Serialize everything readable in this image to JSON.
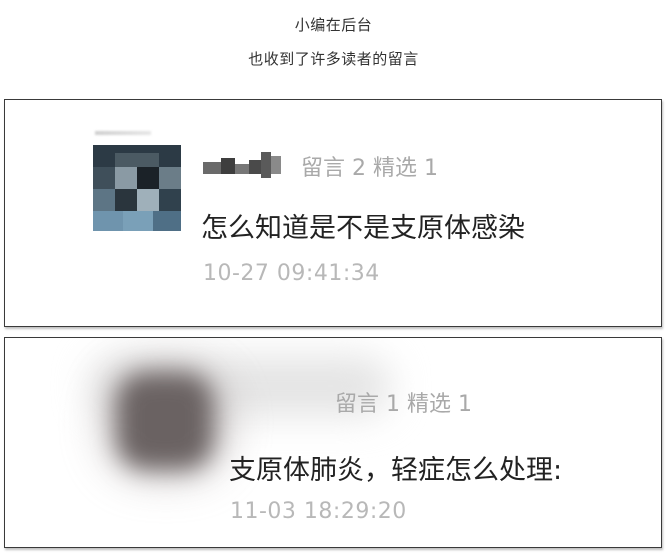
{
  "intro": {
    "line1": "小编在后台",
    "line2": "也收到了许多读者的留言"
  },
  "comments": [
    {
      "stats": "留言 2 精选 1",
      "content": "怎么知道是不是支原体感染",
      "time": "10-27 09:41:34",
      "avatar": "pixelated-avatar",
      "nickname": "pixelated-nickname"
    },
    {
      "stats": "留言 1 精选 1",
      "content": "支原体肺炎，轻症怎么处理:",
      "time": "11-03 18:29:20",
      "avatar": "blurred-avatar",
      "nickname": "blurred-nickname"
    }
  ]
}
